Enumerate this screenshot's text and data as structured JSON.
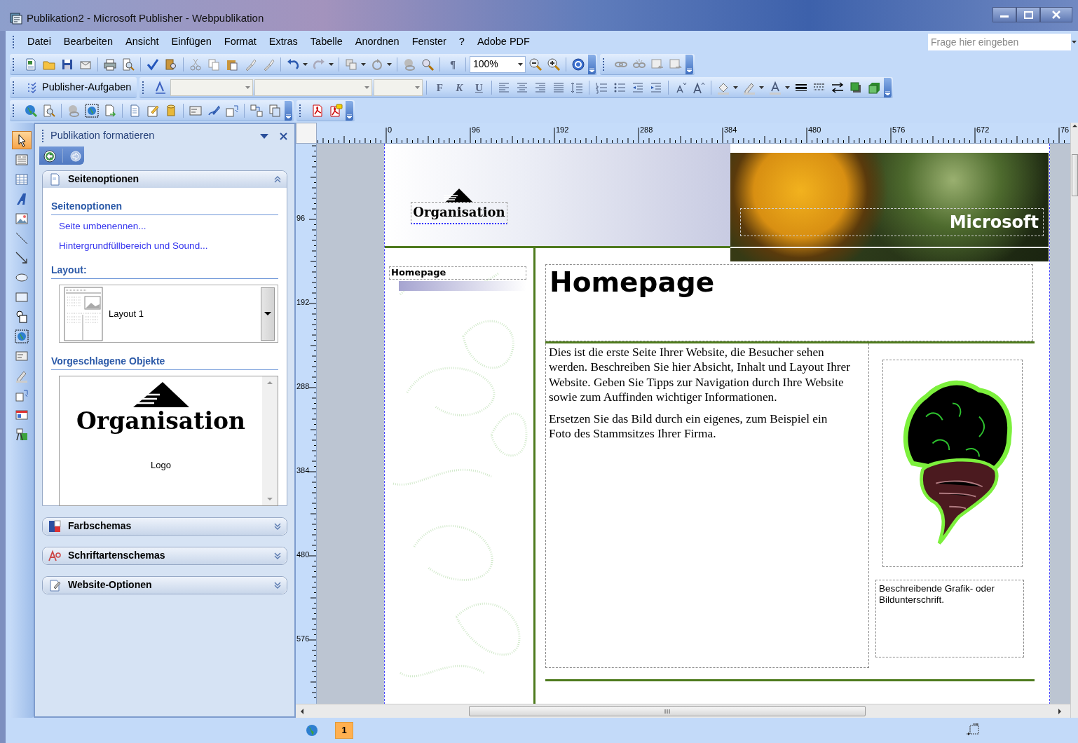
{
  "window": {
    "title": "Publikation2 - Microsoft Publisher - Webpublikation"
  },
  "menu": {
    "items": [
      "Datei",
      "Bearbeiten",
      "Ansicht",
      "Einfügen",
      "Format",
      "Extras",
      "Tabelle",
      "Anordnen",
      "Fenster",
      "?",
      "Adobe PDF"
    ],
    "help_box": {
      "placeholder": "Frage hier eingeben"
    }
  },
  "toolbars": {
    "pilcrow": "¶",
    "zoom": "100%",
    "tasks_button": "Publisher-Aufgaben",
    "format_buttons": [
      "F",
      "K",
      "U"
    ]
  },
  "toolbox": {
    "tools": [
      {
        "kind": "pointer",
        "selected": true
      },
      {
        "kind": "textbox",
        "selected": false
      },
      {
        "kind": "table",
        "selected": false
      },
      {
        "kind": "wordart",
        "selected": false
      },
      {
        "kind": "picture",
        "selected": false
      },
      {
        "kind": "line",
        "selected": false
      },
      {
        "kind": "arrow",
        "selected": false
      },
      {
        "kind": "oval",
        "selected": false
      },
      {
        "kind": "rectangle",
        "selected": false
      },
      {
        "kind": "shapes",
        "selected": false
      },
      {
        "kind": "hotspot",
        "selected": false
      },
      {
        "kind": "form",
        "selected": false
      },
      {
        "kind": "pen",
        "selected": false
      },
      {
        "kind": "insert",
        "selected": false
      },
      {
        "kind": "catalog",
        "selected": false
      },
      {
        "kind": "library",
        "selected": false
      }
    ]
  },
  "task_pane": {
    "title": "Publikation formatieren",
    "sections": [
      {
        "title": "Seitenoptionen",
        "expanded": true,
        "content": {
          "heading": "Seitenoptionen",
          "links": [
            "Seite umbenennen...",
            "Hintergrundfüllbereich und Sound..."
          ],
          "layout_heading": "Layout:",
          "layout_value": "Layout 1",
          "objects_heading": "Vorgeschlagene Objekte",
          "object_logo": "Organisation",
          "object_caption": "Logo"
        }
      },
      {
        "title": "Farbschemas",
        "expanded": false
      },
      {
        "title": "Schriftartenschemas",
        "expanded": false
      },
      {
        "title": "Website-Optionen",
        "expanded": false
      }
    ]
  },
  "ruler": {
    "horizontal": [
      "0",
      "96",
      "192",
      "288",
      "384",
      "480",
      "576",
      "672",
      "76"
    ],
    "vertical": [
      "96",
      "192",
      "288",
      "384",
      "480",
      "576"
    ]
  },
  "page": {
    "logo": "Organisation",
    "banner_text": "Microsoft",
    "nav": [
      "Homepage"
    ],
    "title": "Homepage",
    "body": [
      "Dies ist die erste Seite Ihrer Website, die Besucher sehen werden. Beschreiben Sie hier Absicht, Inhalt und Layout Ihrer Website. Geben Sie Tipps zur Navigation durch Ihre Website sowie zum Auffinden wichtiger Informationen.",
      "Ersetzen Sie das Bild durch ein eigenes, zum Beispiel ein Foto des Stammsitzes Ihrer Firma."
    ],
    "caption": "Beschreibende Grafik- oder Bildunterschrift."
  },
  "status_bar": {
    "pages": [
      {
        "label": "1",
        "selected": true
      }
    ]
  }
}
